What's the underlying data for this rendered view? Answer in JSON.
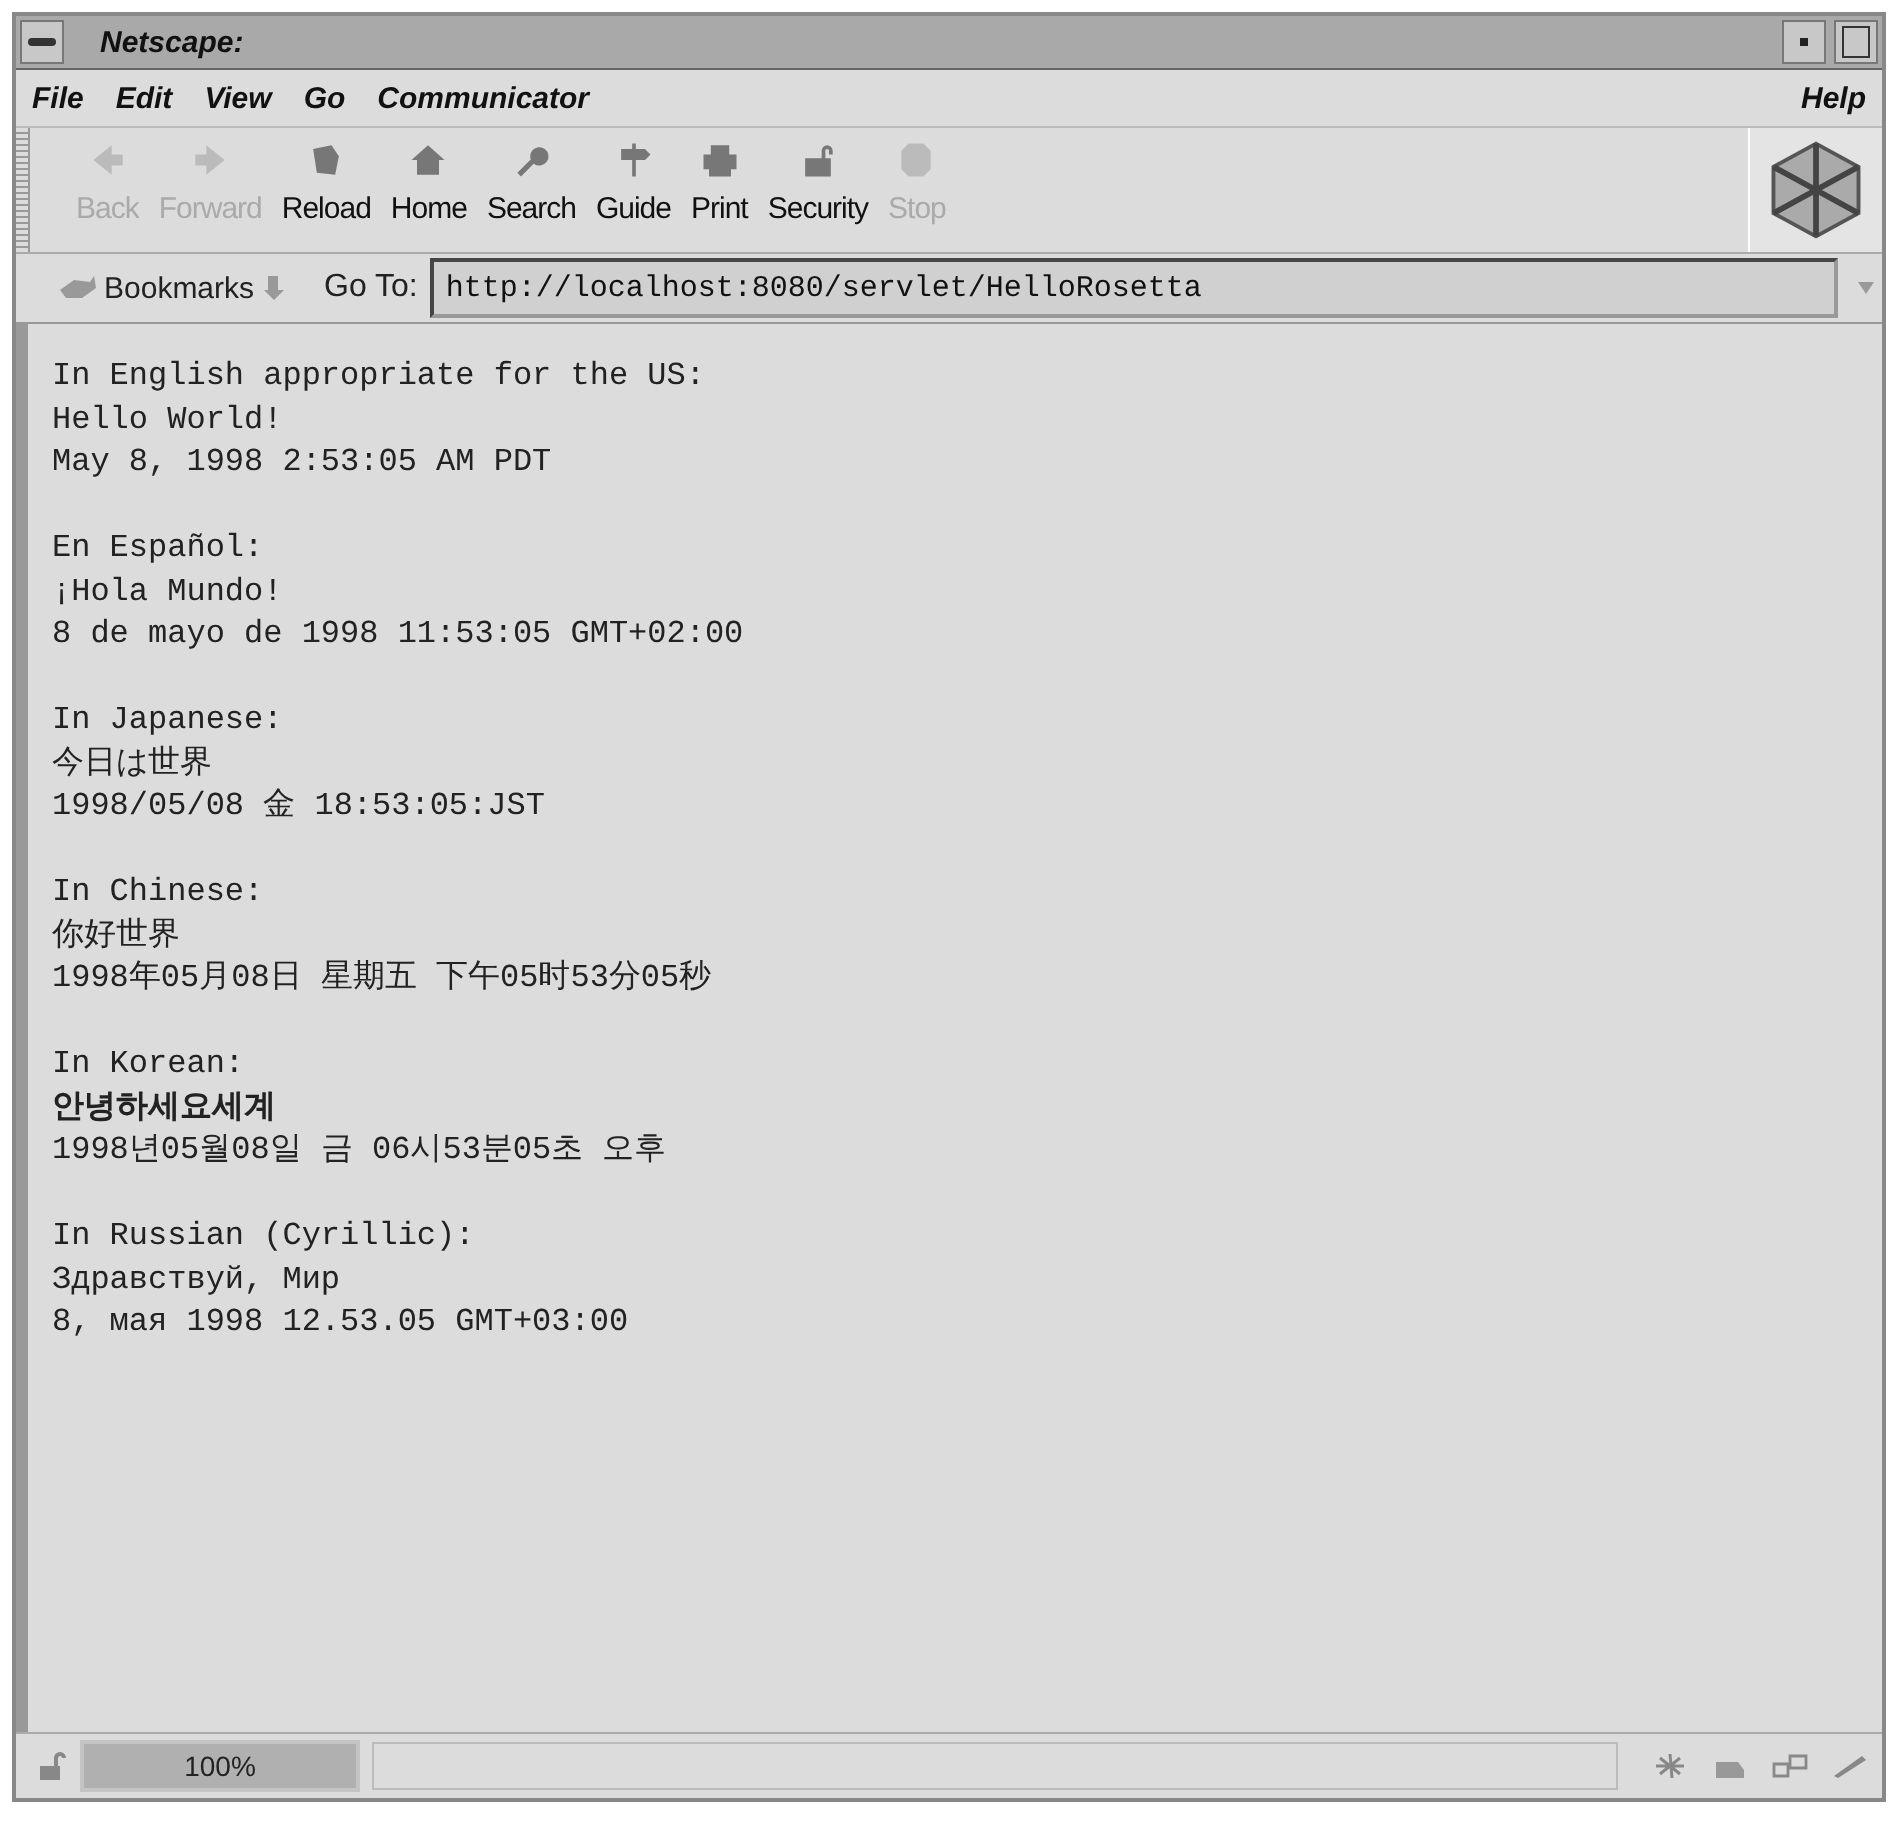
{
  "window": {
    "title": "Netscape:"
  },
  "menu": {
    "left": [
      "File",
      "Edit",
      "View",
      "Go",
      "Communicator"
    ],
    "right": "Help"
  },
  "toolbar": [
    {
      "label": "Back",
      "disabled": true
    },
    {
      "label": "Forward",
      "disabled": true
    },
    {
      "label": "Reload",
      "disabled": false
    },
    {
      "label": "Home",
      "disabled": false
    },
    {
      "label": "Search",
      "disabled": false
    },
    {
      "label": "Guide",
      "disabled": false
    },
    {
      "label": "Print",
      "disabled": false
    },
    {
      "label": "Security",
      "disabled": false
    },
    {
      "label": "Stop",
      "disabled": true
    }
  ],
  "location": {
    "bookmarks": "Bookmarks",
    "goto_label": "Go To:",
    "url": "http://localhost:8080/servlet/HelloRosetta"
  },
  "content": [
    {
      "heading": "In English appropriate for the US:",
      "lines": [
        {
          "text": "Hello World!",
          "bold": false
        },
        {
          "text": "May 8, 1998 2:53:05 AM PDT",
          "bold": false
        }
      ]
    },
    {
      "heading": "En Español:",
      "lines": [
        {
          "text": "¡Hola Mundo!",
          "bold": false
        },
        {
          "text": "8 de mayo de 1998 11:53:05 GMT+02:00",
          "bold": false
        }
      ]
    },
    {
      "heading": "In Japanese:",
      "lines": [
        {
          "text": "今日は世界",
          "bold": false
        },
        {
          "text": "1998/05/08 金 18:53:05:JST",
          "bold": false
        }
      ]
    },
    {
      "heading": "In Chinese:",
      "lines": [
        {
          "text": "你好世界",
          "bold": false
        },
        {
          "text": "1998年05月08日 星期五 下午05时53分05秒",
          "bold": false
        }
      ]
    },
    {
      "heading": "In Korean:",
      "lines": [
        {
          "text": "안녕하세요세계",
          "bold": true
        },
        {
          "text": "1998년05월08일 금 06시53분05초 오후",
          "bold": false
        }
      ]
    },
    {
      "heading": "In Russian (Cyrillic):",
      "lines": [
        {
          "text": "Здравствуй, Мир",
          "bold": false
        },
        {
          "text": "8, мая 1998 12.53.05 GMT+03:00",
          "bold": false
        }
      ]
    }
  ],
  "status_bar": {
    "progress": {
      "text": "100%",
      "level": 1
    }
  }
}
